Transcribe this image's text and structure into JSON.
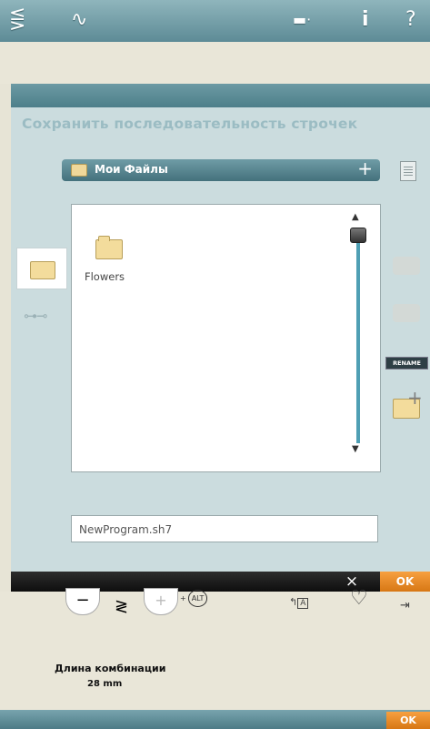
{
  "topbar": {
    "icons": [
      "stitch-menu-icon",
      "stitch-editor-icon",
      "toggle-icon",
      "info-icon",
      "help-icon"
    ],
    "icon_glyphs": [
      "⋚",
      "∿",
      "▬·",
      "i",
      "?"
    ]
  },
  "dialog": {
    "title": "Сохранить последовательность строчек",
    "folder_bar": {
      "label": "Мои Файлы",
      "plus": "+"
    },
    "files": [
      {
        "name": "Flowers",
        "type": "folder"
      }
    ],
    "rename_label": "RENAME",
    "filename": "NewProgram.sh7",
    "cancel_label": "×",
    "ok_label": "OK"
  },
  "lower": {
    "minus_label": "−",
    "plus_label": "+",
    "alt_label": "ALT",
    "alt_prefix": "+",
    "length_label": "Длина комбинации",
    "length_value": "28 mm"
  },
  "bottom": {
    "ok_label": "OK"
  },
  "colors": {
    "accent": "#5d8b96",
    "ok": "#e8891f",
    "panel": "#cbdcde"
  }
}
